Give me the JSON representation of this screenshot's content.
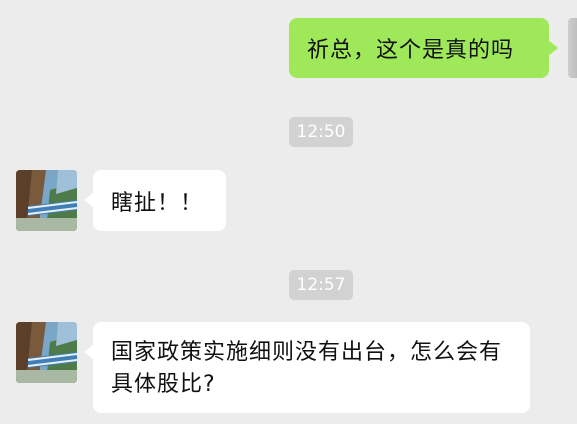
{
  "messages": {
    "outgoing_1": "祈总，这个是真的吗",
    "time_1": "12:50",
    "incoming_1": "瞎扯！！",
    "time_2": "12:57",
    "incoming_2": "国家政策实施细则没有出台，怎么会有具体股比?"
  },
  "colors": {
    "background": "#ececec",
    "outgoing_bubble": "#9fe85a",
    "incoming_bubble": "#ffffff",
    "timestamp_bg": "#d2d2d2"
  },
  "icons": {
    "contact_avatar": "avatar-landscape-train"
  }
}
